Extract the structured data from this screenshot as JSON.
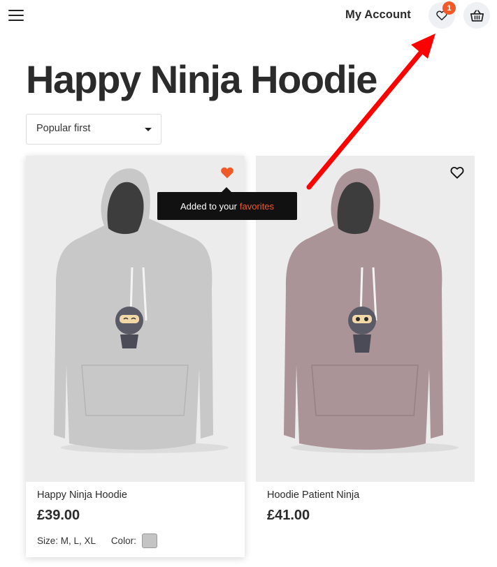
{
  "header": {
    "my_account_label": "My Account",
    "wishlist_count": "1",
    "wishlist_icon": "heart-outline-icon",
    "cart_icon": "basket-icon",
    "menu_icon": "hamburger-icon"
  },
  "page": {
    "title": "Happy Ninja Hoodie"
  },
  "sort": {
    "selected": "Popular first"
  },
  "tooltip": {
    "text": "Added to your",
    "highlight": "favorites"
  },
  "products": [
    {
      "name": "Happy Ninja Hoodie",
      "price": "£39.00",
      "sizes_label": "Size: M, L, XL",
      "color_label": "Color:",
      "swatch_color": "#c4c4c4",
      "hoodie_color": "#c8c8c8",
      "favorited": true
    },
    {
      "name": "Hoodie Patient Ninja",
      "price": "£41.00",
      "favorited": false,
      "hoodie_color": "#ab9497"
    }
  ],
  "colors": {
    "accent": "#f05a28",
    "annotation_arrow": "#ff0000"
  }
}
